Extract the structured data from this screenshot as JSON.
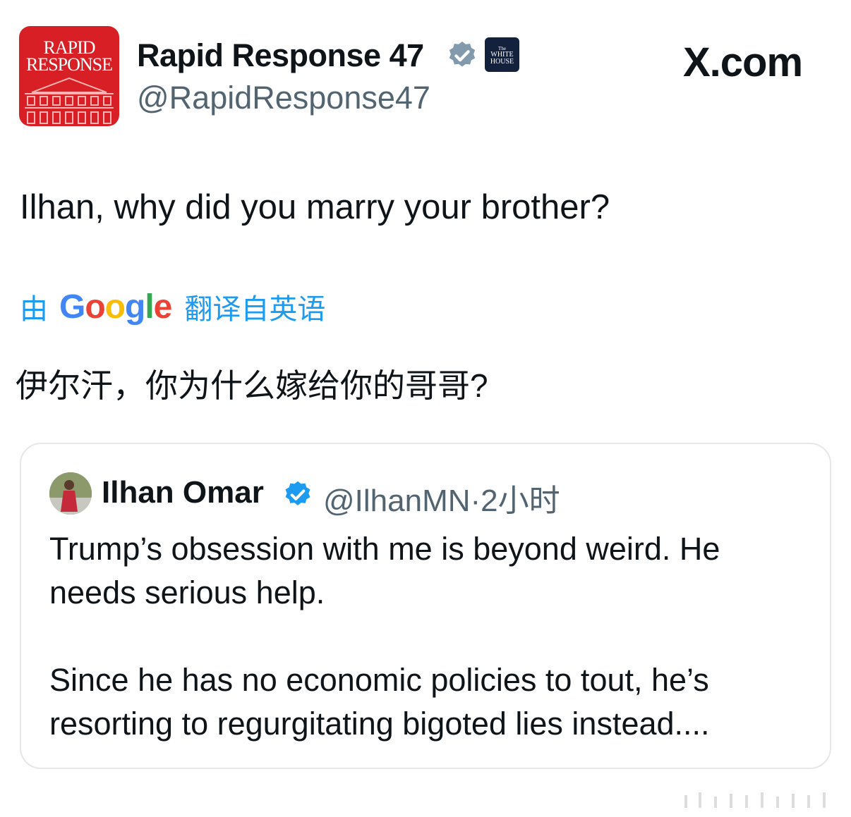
{
  "author": {
    "avatar_text_line1": "RAPID",
    "avatar_text_line2": "RESPONSE",
    "name": "Rapid Response 47",
    "handle": "@RapidResponse47",
    "verified_badge": "gray-check-icon",
    "affiliate_badge": [
      "The",
      "WHITE",
      "HOUSE"
    ]
  },
  "site_label": "X.com",
  "tweet": {
    "text": "Ilhan, why did you marry your brother?"
  },
  "translation": {
    "prefix": "由",
    "google": [
      "G",
      "o",
      "o",
      "g",
      "l",
      "e"
    ],
    "suffix": "翻译自英语",
    "text": "伊尔汗，你为什么嫁给你的哥哥?"
  },
  "quoted_tweet": {
    "name": "Ilhan Omar",
    "handle": "@IlhanMN",
    "separator": "·",
    "time": "2小时",
    "paragraph1": "Trump’s obsession with me is beyond weird. He needs serious help.",
    "paragraph2": "Since he has no economic policies to tout, he’s resorting to regurgitating bigoted lies instead...."
  },
  "colors": {
    "avatar_red": "#d81f26",
    "link_blue": "#1d9bf0",
    "secondary_text": "#536471",
    "verified_gray": "#829aab",
    "verified_blue": "#1d9bf0",
    "border": "#e7e7e7"
  }
}
